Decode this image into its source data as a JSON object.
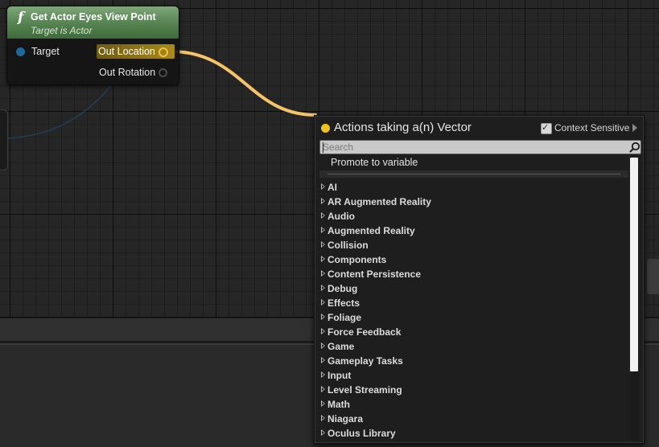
{
  "node": {
    "title": "Get Actor Eyes View Point",
    "subtitle": "Target is Actor",
    "function_icon": "f",
    "pins": {
      "input_target": "Target",
      "output_location": "Out Location",
      "output_rotation": "Out Rotation"
    }
  },
  "action_menu": {
    "title": "Actions taking a(n) Vector",
    "context_sensitive_label": "Context Sensitive",
    "context_sensitive_checked": true,
    "search_placeholder": "Search",
    "search_value": "",
    "promote_item": "Promote to variable",
    "categories": [
      "AI",
      "AR Augmented Reality",
      "Audio",
      "Augmented Reality",
      "Collision",
      "Components",
      "Content Persistence",
      "Debug",
      "Effects",
      "Foliage",
      "Force Feedback",
      "Game",
      "Gameplay Tasks",
      "Input",
      "Level Streaming",
      "Math",
      "Niagara",
      "Oculus Library"
    ]
  },
  "colors": {
    "vector_pin": "#f3c23c",
    "object_pin": "#1e6a96",
    "node_header": "#5b8856",
    "wire": "#f5c468",
    "graph_background": "#262626"
  },
  "icons": {
    "function": "function-icon",
    "search": "search-icon",
    "checkbox": "checkbox-checked-icon",
    "expand": "chevron-right-icon"
  }
}
